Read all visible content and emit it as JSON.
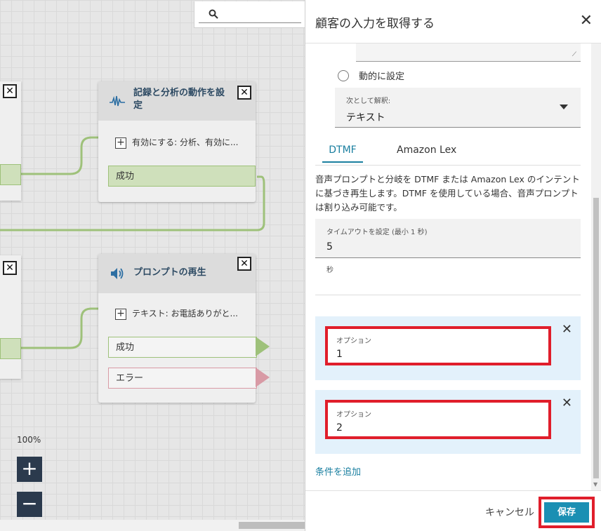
{
  "canvas": {
    "blocks": [
      {
        "title": "記録と分析の動作を設定",
        "param": "有効にする: 分析、有効に...",
        "branches": [
          "成功"
        ]
      },
      {
        "title": "プロンプトの再生",
        "param": "テキスト: お電話ありがと...",
        "branches": [
          "成功",
          "エラー"
        ]
      }
    ],
    "zoom": {
      "level": "100%",
      "in": "+",
      "out": "−"
    },
    "close_glyph": "✕",
    "plus_glyph": "+"
  },
  "panel": {
    "title": "顧客の入力を取得する",
    "close": "✕",
    "radio_label": "動的に設定",
    "interpret_label": "次として解釈:",
    "interpret_value": "テキスト",
    "tabs": [
      "DTMF",
      "Amazon Lex"
    ],
    "description": "音声プロンプトと分岐を DTMF または Amazon Lex のインテントに基づき再生します。DTMF を使用している場合、音声プロンプトは割り込み可能です。",
    "timeout_label": "タイムアウトを設定 (最小 1 秒)",
    "timeout_value": "5",
    "timeout_unit": "秒",
    "options": [
      {
        "label": "オプション",
        "value": "1"
      },
      {
        "label": "オプション",
        "value": "2"
      }
    ],
    "add_condition": "条件を追加",
    "cancel": "キャンセル",
    "save": "保存"
  },
  "colors": {
    "accent": "#1a8fb3",
    "highlight": "#e01e2b",
    "success_branch": "#9ec17a",
    "error_branch": "#d89aa5",
    "block_title": "#2d4a63"
  }
}
